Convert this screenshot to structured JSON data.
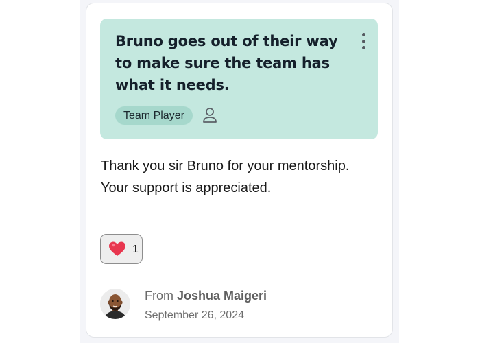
{
  "card": {
    "headline": "Bruno goes out of their way to make sure the team has what it needs.",
    "tag": "Team Player",
    "menu_icon": "kebab-menu-icon",
    "recipient_icon": "person-icon",
    "message": "Thank you sir Bruno for your mentorship. Your support is appreciated.",
    "reaction": {
      "emoji": "heart-icon",
      "count": "1"
    },
    "author": {
      "prefix": "From",
      "name": "Joshua Maigeri",
      "date": "September 26, 2024"
    }
  },
  "colors": {
    "highlight_bg": "#c4e8df",
    "tag_bg": "#a6d8cc",
    "heart": "#e8364f"
  }
}
